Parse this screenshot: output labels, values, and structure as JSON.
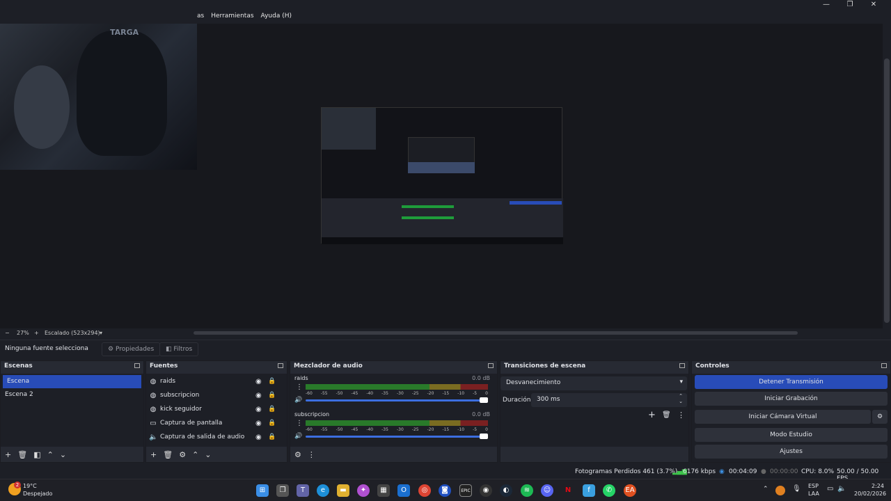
{
  "menu": [
    "as",
    "Herramientas",
    "Ayuda (H)"
  ],
  "window_controls": [
    "—",
    "❐",
    "✕"
  ],
  "camera_text": "TARGA",
  "zoombar": {
    "minus": "−",
    "zoom": "27%",
    "plus": "+",
    "scale": "Escalado (523x294)",
    "dropdown": "▾"
  },
  "propbar": {
    "label": "Ninguna fuente selecciona",
    "properties": "Propiedades",
    "filters": "Filtros"
  },
  "scenes": {
    "title": "Escenas",
    "items": [
      "Escena",
      "Escena 2"
    ],
    "selected": "Escena"
  },
  "sources": {
    "title": "Fuentes",
    "items": [
      {
        "name": "raids",
        "icon": "globe-icon"
      },
      {
        "name": "subscripcion",
        "icon": "globe-icon"
      },
      {
        "name": "kick seguidor",
        "icon": "globe-icon"
      },
      {
        "name": "Captura de pantalla",
        "icon": "monitor-icon"
      },
      {
        "name": "Captura de salida de audio",
        "icon": "speaker-icon"
      }
    ]
  },
  "mixer": {
    "title": "Mezclador de audio",
    "ticks": [
      "-60",
      "-55",
      "-50",
      "-45",
      "-40",
      "-35",
      "-30",
      "-25",
      "-20",
      "-15",
      "-10",
      "-5",
      "0"
    ],
    "channels": [
      {
        "name": "raids",
        "db": "0.0 dB"
      },
      {
        "name": "subscripcion",
        "db": "0.0 dB"
      }
    ]
  },
  "transitions": {
    "title": "Transiciones de escena",
    "selected": "Desvanecimiento",
    "duration_label": "Duración",
    "duration_value": "300 ms"
  },
  "controls": {
    "title": "Controles",
    "buttons": [
      "Detener Transmisión",
      "Iniciar Grabación",
      "Iniciar Cámara Virtual",
      "Modo Estudio",
      "Ajustes"
    ]
  },
  "status": {
    "dropped": "Fotogramas Perdidos 461 (3.7%)",
    "bitrate": "6176 kbps",
    "stream_time": "00:04:09",
    "rec_time": "00:00:00",
    "cpu": "CPU: 8.0%",
    "fps": "50.00 / 50.00 FPS"
  },
  "taskbar": {
    "weather_temp": "19°C",
    "weather_desc": "Despejado",
    "weather_badge": "2",
    "lang": "ESP",
    "lang2": "LAA",
    "time": "2:24",
    "date": "20/02/2026"
  },
  "colors": {
    "accent": "#284cb8",
    "bg": "#1d1f26",
    "panel": "#272a33"
  }
}
